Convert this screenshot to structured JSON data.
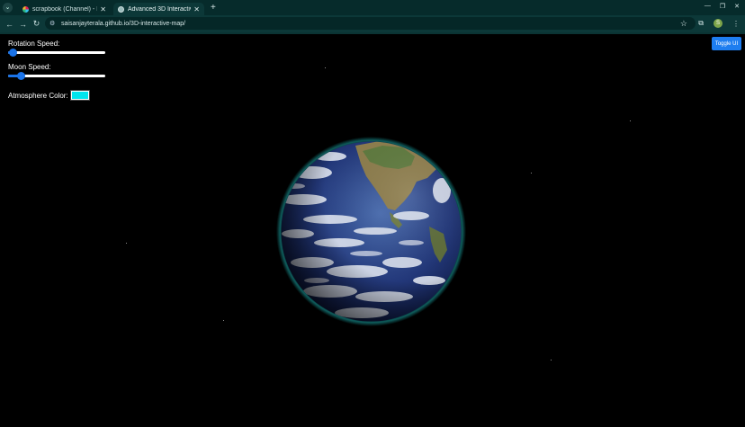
{
  "browser": {
    "tabs": [
      {
        "title": "scrapbook (Channel) - H...",
        "active": false
      },
      {
        "title": "Advanced 3D Interactive",
        "active": true
      }
    ],
    "url": "saisanjayterala.github.io/3D-interactive-map/",
    "profile_initial": "S"
  },
  "controls": {
    "rotation_speed": {
      "label": "Rotation Speed:",
      "value": 0.05
    },
    "moon_speed": {
      "label": "Moon Speed:",
      "value": 0.13
    },
    "atmosphere_color": {
      "label": "Atmosphere Color:",
      "value": "#00e5ee"
    }
  },
  "toggle_button": {
    "label": "Toggle UI"
  },
  "colors": {
    "accent": "#1a73e8",
    "page_bg": "#000000",
    "chrome_bg": "#0c3838"
  },
  "icons": [
    "tab-list-icon",
    "favicon-icon",
    "globe-favicon-icon",
    "close-icon",
    "new-tab-icon",
    "back-icon",
    "forward-icon",
    "reload-icon",
    "site-info-icon",
    "bookmark-star-icon",
    "extensions-icon",
    "menu-icon",
    "minimize-icon",
    "maximize-icon"
  ]
}
